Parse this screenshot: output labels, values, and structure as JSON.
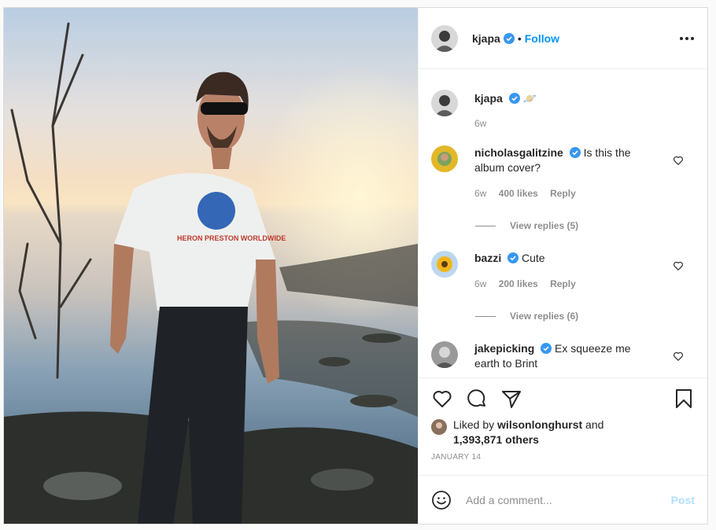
{
  "header": {
    "username": "kjapa",
    "separator": "•",
    "follow_label": "Follow",
    "more_icon": "more-options-icon"
  },
  "caption": {
    "username": "kjapa",
    "text": "🪐",
    "time": "6w"
  },
  "comments": [
    {
      "username": "nicholasgalitzine",
      "text": "Is this the album cover?",
      "time": "6w",
      "likes": "400 likes",
      "reply": "Reply",
      "view_replies": "View replies (5)"
    },
    {
      "username": "bazzi",
      "text": "Cute",
      "time": "6w",
      "likes": "200 likes",
      "reply": "Reply",
      "view_replies": "View replies (6)"
    },
    {
      "username": "jakepicking",
      "text": "Ex squeeze me earth to Brint"
    }
  ],
  "likes": {
    "prefix": "Liked by ",
    "user": "wilsonlonghurst",
    "and": " and",
    "others": "1,393,871 others"
  },
  "date": "JANUARY 14",
  "add_comment": {
    "placeholder": "Add a comment...",
    "post_label": "Post"
  },
  "colors": {
    "accent": "#0095f6",
    "verified": "#3897f0",
    "muted": "#8e8e8e",
    "post_disabled": "#b2dffc"
  }
}
